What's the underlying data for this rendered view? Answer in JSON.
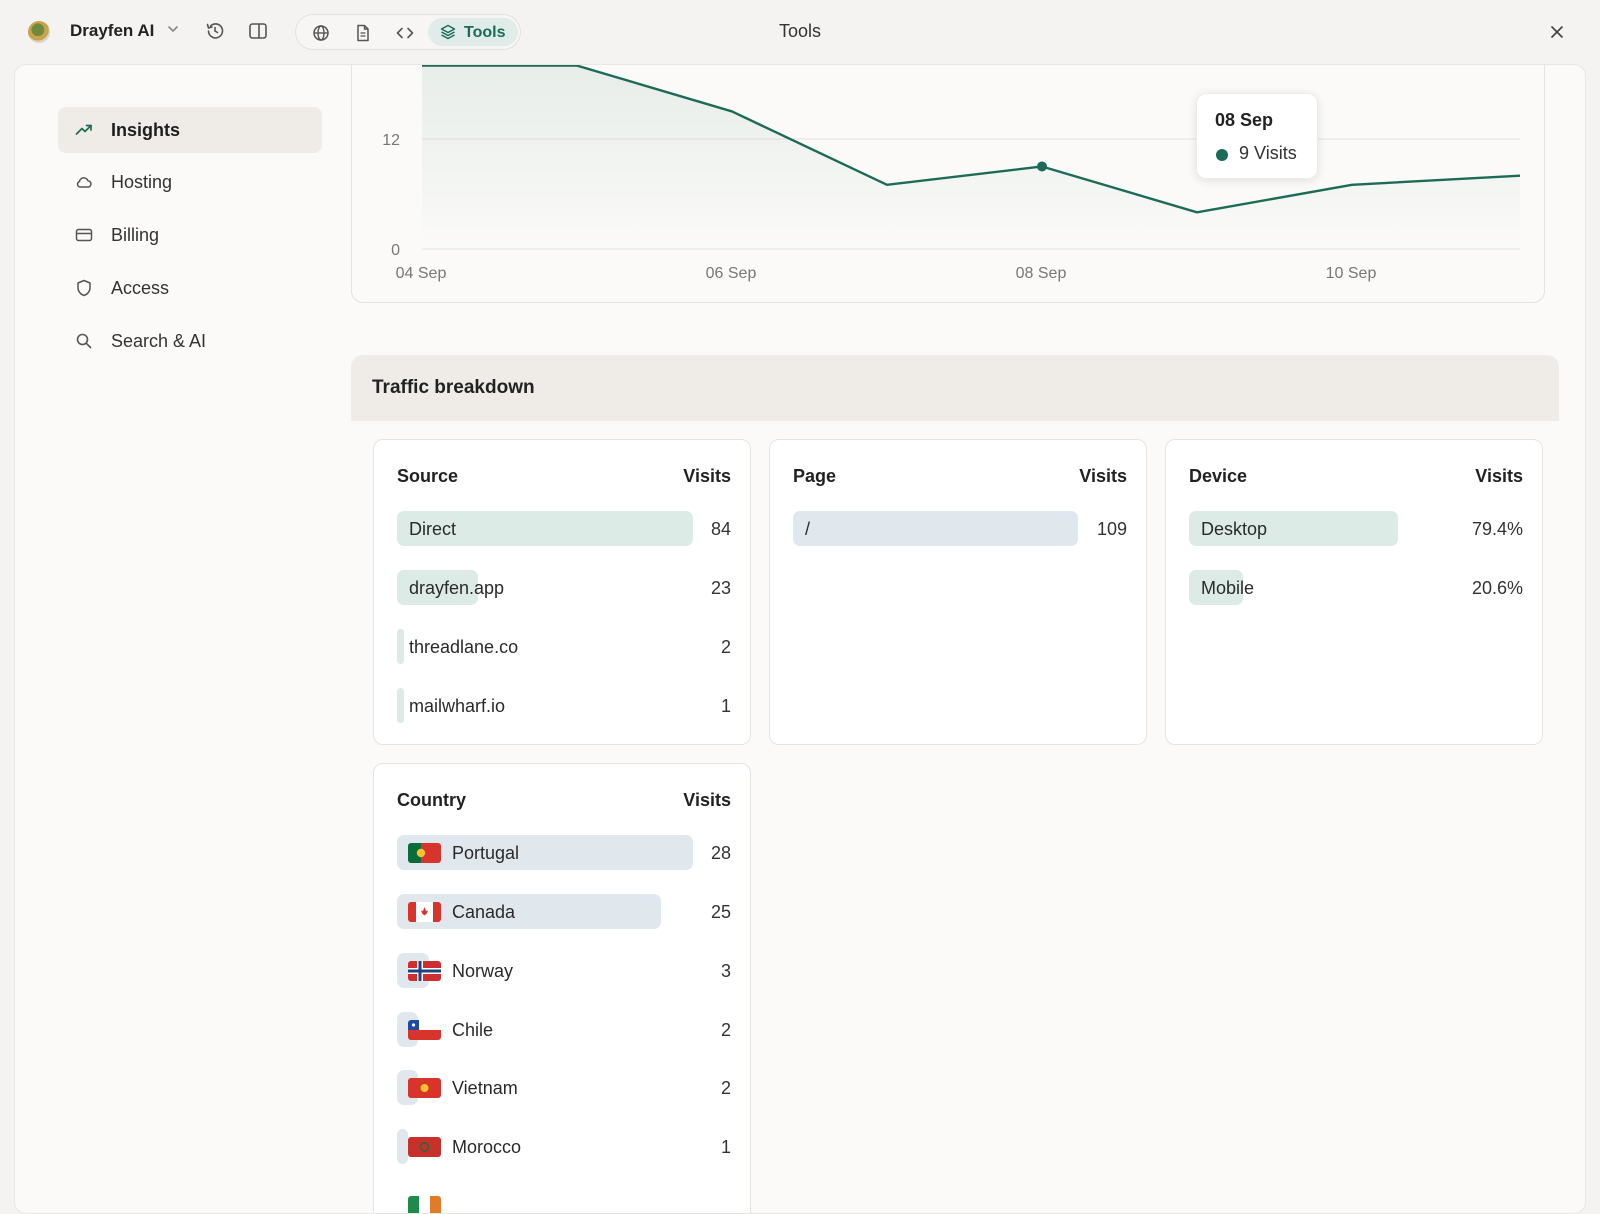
{
  "app": {
    "name": "Drayfen AI",
    "window_title": "Tools",
    "tools_label": "Tools"
  },
  "sidebar": {
    "items": [
      {
        "label": "Insights",
        "icon": "trending-up-icon",
        "active": true
      },
      {
        "label": "Hosting",
        "icon": "cloud-icon",
        "active": false
      },
      {
        "label": "Billing",
        "icon": "credit-card-icon",
        "active": false
      },
      {
        "label": "Access",
        "icon": "shield-icon",
        "active": false
      },
      {
        "label": "Search & AI",
        "icon": "search-icon",
        "active": false
      }
    ]
  },
  "chart_data": {
    "type": "line",
    "x": [
      "04 Sep",
      "05 Sep",
      "06 Sep",
      "07 Sep",
      "08 Sep",
      "09 Sep",
      "10 Sep",
      "11 Sep"
    ],
    "series": [
      {
        "values": [
          20,
          20,
          15,
          7,
          9,
          4,
          7,
          8
        ]
      }
    ],
    "y_ticks": [
      "0",
      "12"
    ],
    "x_tick_labels": [
      "04 Sep",
      "06 Sep",
      "08 Sep",
      "10 Sep"
    ],
    "ylim": [
      0,
      20
    ],
    "grid": true,
    "accent_color": "#1b6b58",
    "highlight": {
      "index": 4
    }
  },
  "tooltip": {
    "date": "08 Sep",
    "value": "9 Visits"
  },
  "traffic": {
    "title": "Traffic breakdown",
    "source": {
      "header": "Source",
      "value_header": "Visits",
      "rows": [
        {
          "label": "Direct",
          "value": "84",
          "share": 1.0
        },
        {
          "label": "drayfen.app",
          "value": "23",
          "share": 0.274
        },
        {
          "label": "threadlane.co",
          "value": "2",
          "share": 0.024
        },
        {
          "label": "mailwharf.io",
          "value": "1",
          "share": 0.012
        }
      ]
    },
    "page": {
      "header": "Page",
      "value_header": "Visits",
      "rows": [
        {
          "label": "/",
          "value": "109",
          "share": 1.0
        }
      ]
    },
    "device": {
      "header": "Device",
      "value_header": "Visits",
      "rows": [
        {
          "label": "Desktop",
          "value": "79.4%",
          "share": 0.794
        },
        {
          "label": "Mobile",
          "value": "20.6%",
          "share": 0.206
        }
      ]
    },
    "country": {
      "header": "Country",
      "value_header": "Visits",
      "rows": [
        {
          "label": "Portugal",
          "value": "28",
          "share": 1.0,
          "flag": "portugal-flag-icon"
        },
        {
          "label": "Canada",
          "value": "25",
          "share": 0.893,
          "flag": "canada-flag-icon"
        },
        {
          "label": "Norway",
          "value": "3",
          "share": 0.107,
          "flag": "norway-flag-icon"
        },
        {
          "label": "Chile",
          "value": "2",
          "share": 0.071,
          "flag": "chile-flag-icon"
        },
        {
          "label": "Vietnam",
          "value": "2",
          "share": 0.071,
          "flag": "vietnam-flag-icon"
        },
        {
          "label": "Morocco",
          "value": "1",
          "share": 0.036,
          "flag": "morocco-flag-icon"
        }
      ]
    }
  }
}
